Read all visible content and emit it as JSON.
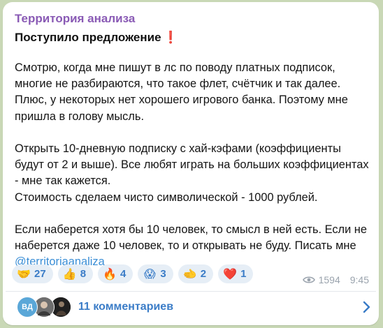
{
  "post": {
    "channel_name": "Территория анализа",
    "headline": "Поступило предложение",
    "headline_mark": "❗",
    "paragraphs": [
      "Смотрю, когда мне пишут в лс по поводу платных подписок, многие не разбираются, что такое флет, счётчик и так далее. Плюс, у некоторых нет хорошего игрового банка. Поэтому мне пришла в голову мысль.",
      "Открыть 10-дневную подписку с хай-кэфами (коэффициенты будут от 2 и выше). Все любят играть на больших коэффициентах - мне так кажется.",
      "Стоимость сделаем чисто символической - 1000 рублей.",
      "Если наберется хотя бы 10 человек, то смысл в ней есть. Если не наберется даже 10 человек, то и открывать не буду. Писать мне"
    ],
    "mention": "@territoriaanaliza"
  },
  "reactions": [
    {
      "emoji": "🤝",
      "icon": "handshake-icon",
      "count": "27"
    },
    {
      "emoji": "👍",
      "icon": "thumbs-up-icon",
      "count": "8"
    },
    {
      "emoji": "🔥",
      "icon": "fire-icon",
      "count": "4"
    },
    {
      "emoji": "😱",
      "icon": "screaming-face-icon",
      "count": "3"
    },
    {
      "emoji": "🫲",
      "icon": "pointing-hand-icon",
      "count": "2"
    },
    {
      "emoji": "❤️",
      "icon": "heart-icon",
      "count": "1"
    }
  ],
  "meta": {
    "views": "1594",
    "time": "9:45"
  },
  "comments": {
    "avatar_initials": "ВД",
    "label": "11 комментариев"
  },
  "colors": {
    "channel": "#8a5bb5",
    "accent": "#3a7cc7",
    "reaction_bg": "#e6eef6",
    "background": "#c9d8b6"
  }
}
